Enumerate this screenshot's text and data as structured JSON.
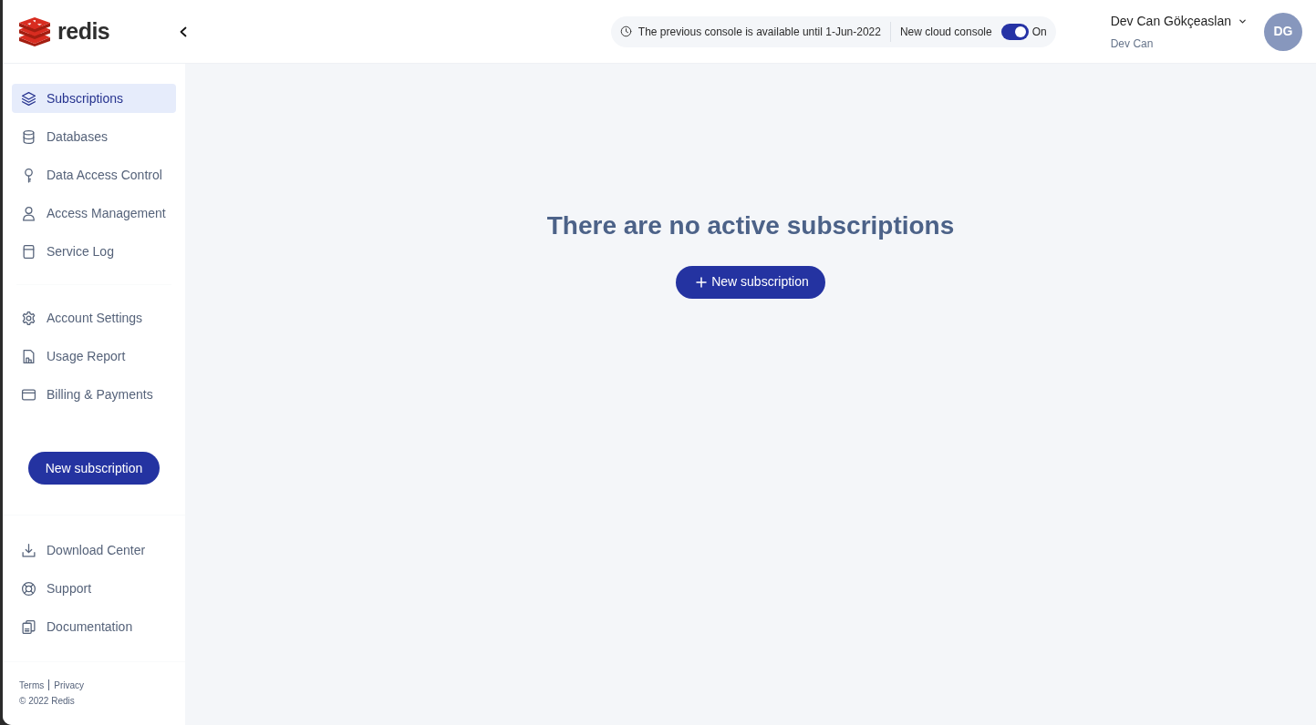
{
  "sidebar": {
    "logo": {
      "text": "redis"
    },
    "nav_groups": [
      {
        "items": [
          {
            "label": "Subscriptions",
            "selected": true
          },
          {
            "label": "Databases",
            "selected": false
          },
          {
            "label": "Data Access Control",
            "selected": false
          },
          {
            "label": "Access Management",
            "selected": false
          },
          {
            "label": "Service Log",
            "selected": false
          }
        ]
      },
      {
        "items": [
          {
            "label": "Account Settings",
            "selected": false
          },
          {
            "label": "Usage Report",
            "selected": false
          },
          {
            "label": "Billing & Payments",
            "selected": false
          }
        ]
      }
    ],
    "new_subscription_button": {
      "label": "New subscription"
    },
    "bottom_links": {
      "items": [
        {
          "label": "Download Center",
          "selected": false
        },
        {
          "label": "Support",
          "selected": false
        },
        {
          "label": "Documentation",
          "selected": false
        }
      ]
    },
    "footer": {
      "links": [
        {
          "label": "Terms"
        },
        {
          "label": "Privacy"
        }
      ],
      "copyright": "© 2022 Redis"
    }
  },
  "header": {
    "notice": {
      "text": "The previous console is available until 1-Jun-2022"
    },
    "console_toggle": {
      "label": "New cloud console",
      "on": true,
      "state_text": "On"
    },
    "user": {
      "name": "Dev Can Gökçeaslan",
      "account": "Dev Can",
      "initials": "DG"
    }
  },
  "main": {
    "empty_title": "There are no active subscriptions",
    "action_button": {
      "label": "New subscription"
    }
  }
}
